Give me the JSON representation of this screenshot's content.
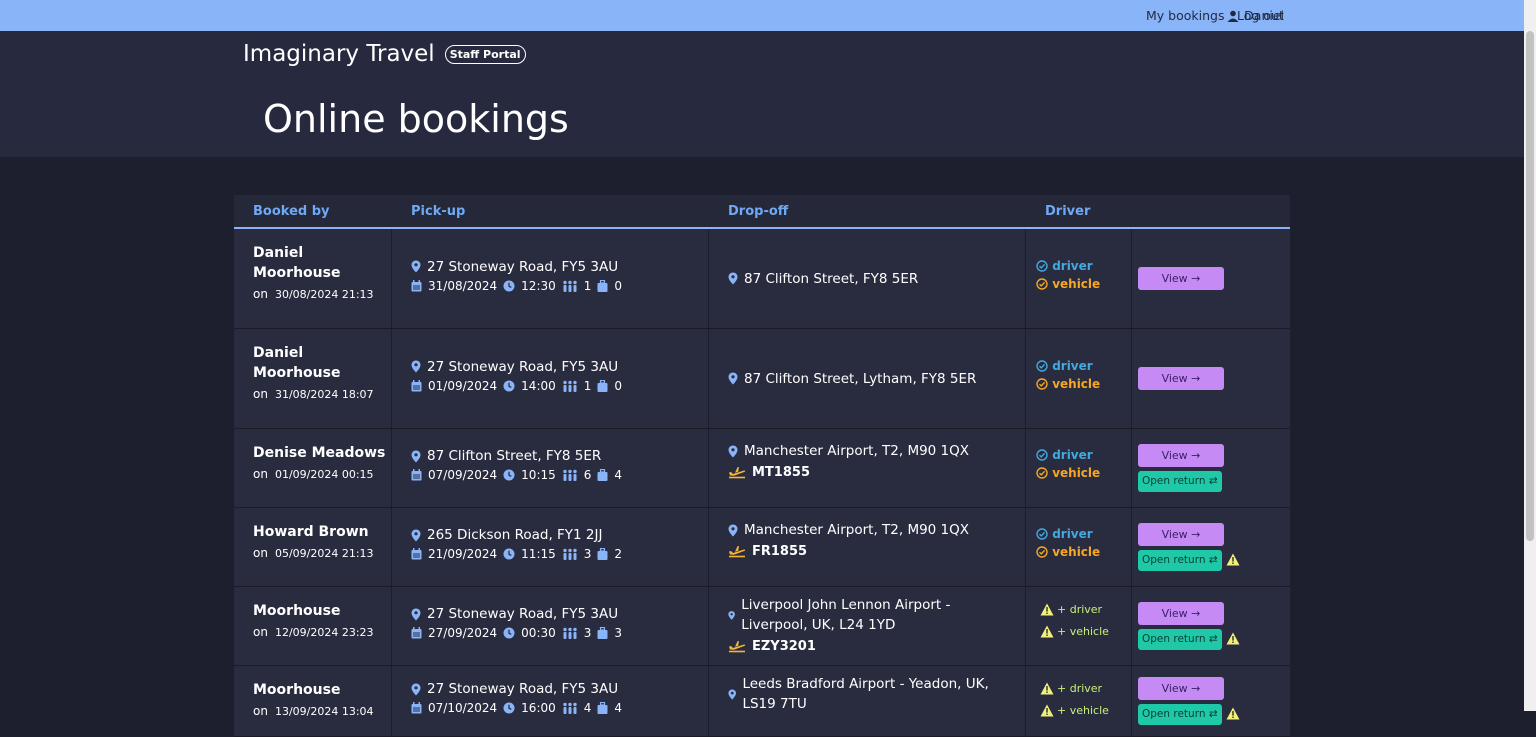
{
  "nav": {
    "user": "Daniel",
    "my_bookings": "My bookings",
    "logout": "Log out"
  },
  "brand": {
    "name": "Imaginary Travel",
    "badge": "Staff Portal"
  },
  "page_title": "Online bookings",
  "table": {
    "headers": [
      "Booked by",
      "Pick-up",
      "Drop-off",
      "Driver"
    ],
    "view_label": "View →",
    "open_return_label": "Open return ⇄",
    "driver_label": "driver",
    "vehicle_label": "vehicle",
    "add_driver_label": "+ driver",
    "add_vehicle_label": "+ vehicle",
    "rows": [
      {
        "booked_by": "Daniel Moorhouse",
        "on": "on",
        "booked_at": "30/08/2024 21:13",
        "pickup": "27  Stoneway Road, FY5 3AU",
        "date": "31/08/2024",
        "time": "12:30",
        "pax": "1",
        "bags": "0",
        "dropoff": "87 Clifton Street, FY8 5ER",
        "flight": ""
      },
      {
        "booked_by": "Daniel Moorhouse",
        "on": "on",
        "booked_at": "31/08/2024 18:07",
        "pickup": "27  Stoneway Road, FY5 3AU",
        "date": "01/09/2024",
        "time": "14:00",
        "pax": "1",
        "bags": "0",
        "dropoff": "87 Clifton Street, Lytham, FY8 5ER",
        "flight": ""
      },
      {
        "booked_by": "Denise Meadows",
        "on": "on",
        "booked_at": "01/09/2024 00:15",
        "pickup": "87  Clifton Street, FY8 5ER",
        "date": "07/09/2024",
        "time": "10:15",
        "pax": "6",
        "bags": "4",
        "dropoff": "Manchester Airport, T2, M90 1QX",
        "flight": "MT1855"
      },
      {
        "booked_by": "Howard Brown",
        "on": "on",
        "booked_at": "05/09/2024 21:13",
        "pickup": "265  Dickson Road, FY1 2JJ",
        "date": "21/09/2024",
        "time": "11:15",
        "pax": "3",
        "bags": "2",
        "dropoff": "Manchester Airport, T2, M90 1QX",
        "flight": "FR1855"
      },
      {
        "booked_by": "Moorhouse",
        "on": "on",
        "booked_at": "12/09/2024 23:23",
        "pickup": "27  Stoneway Road, FY5 3AU",
        "date": "27/09/2024",
        "time": "00:30",
        "pax": "3",
        "bags": "3",
        "dropoff": "Liverpool John Lennon Airport - Liverpool, UK, L24 1YD",
        "flight": "EZY3201"
      },
      {
        "booked_by": "Moorhouse",
        "on": "on",
        "booked_at": "13/09/2024 13:04",
        "pickup": "27  Stoneway Road, FY5 3AU",
        "date": "07/10/2024",
        "time": "16:00",
        "pax": "4",
        "bags": "4",
        "dropoff": "Leeds Bradford Airport - Yeadon, UK, LS19 7TU",
        "flight": ""
      }
    ]
  },
  "colors": {
    "topbar": "#8ab4f8",
    "accent_blue": "#6fa8f5",
    "view_button": "#c68af5",
    "return_button": "#1fc9a8",
    "status_blue": "#3fa9e0",
    "status_orange": "#f5a623",
    "warning": "#f0f07a"
  },
  "icons": {
    "user": "user-icon",
    "pin": "map-pin-icon",
    "calendar": "calendar-icon",
    "clock": "clock-icon",
    "people": "people-icon",
    "luggage": "luggage-icon",
    "plane": "plane-icon",
    "check": "check-circle-icon",
    "warning": "warning-icon"
  }
}
